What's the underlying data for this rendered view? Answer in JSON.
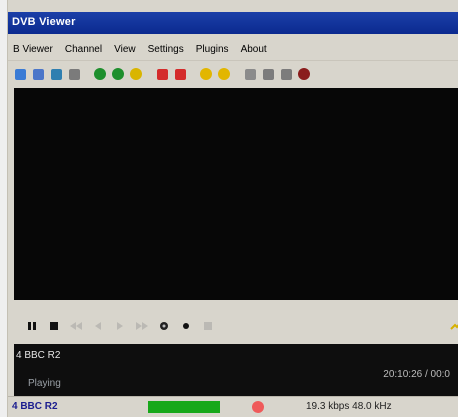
{
  "window": {
    "title": "DVB Viewer"
  },
  "menu": [
    {
      "label": "B Viewer"
    },
    {
      "label": "Channel"
    },
    {
      "label": "View"
    },
    {
      "label": "Settings"
    },
    {
      "label": "Plugins"
    },
    {
      "label": "About"
    }
  ],
  "toolbar": [
    {
      "icon": "screen-icon",
      "color": "#3a7bd5"
    },
    {
      "icon": "document-icon",
      "color": "#4b76c9"
    },
    {
      "icon": "picture-icon",
      "color": "#2f7fb0"
    },
    {
      "icon": "camera-icon",
      "color": "#7b7b7b"
    },
    {
      "icon": "back-icon",
      "color": "#1e8f2d"
    },
    {
      "icon": "forward-icon",
      "color": "#1e8f2d"
    },
    {
      "icon": "star-icon",
      "color": "#d9b500"
    },
    {
      "icon": "record-icon",
      "color": "#d42b2b"
    },
    {
      "icon": "stop-record-icon",
      "color": "#d42b2b"
    },
    {
      "icon": "sun-icon",
      "color": "#e2b600"
    },
    {
      "icon": "sun-icon",
      "color": "#e2b600"
    },
    {
      "icon": "settings-icon",
      "color": "#8b8b8b"
    },
    {
      "icon": "list-icon",
      "color": "#7c7c7c"
    },
    {
      "icon": "tools-icon",
      "color": "#7c7c7c"
    },
    {
      "icon": "record-dot-icon",
      "color": "#8a1c1c"
    }
  ],
  "controls": [
    {
      "icon": "pause-icon",
      "enabled": true
    },
    {
      "icon": "stop-icon",
      "enabled": true
    },
    {
      "icon": "rewind-icon",
      "enabled": false
    },
    {
      "icon": "back-icon",
      "enabled": false
    },
    {
      "icon": "forward-icon",
      "enabled": false
    },
    {
      "icon": "fast-forward-icon",
      "enabled": false
    },
    {
      "icon": "eye-icon",
      "enabled": true
    },
    {
      "icon": "dot-icon",
      "enabled": true
    },
    {
      "icon": "marker-icon",
      "enabled": false
    }
  ],
  "info": {
    "channel": "4 BBC R2",
    "time": "20:10:26 / 00:0",
    "state": "Playing"
  },
  "status": {
    "channel": "4 BBC R2",
    "bitrate": "19.3 kbps 48.0 kHz"
  }
}
